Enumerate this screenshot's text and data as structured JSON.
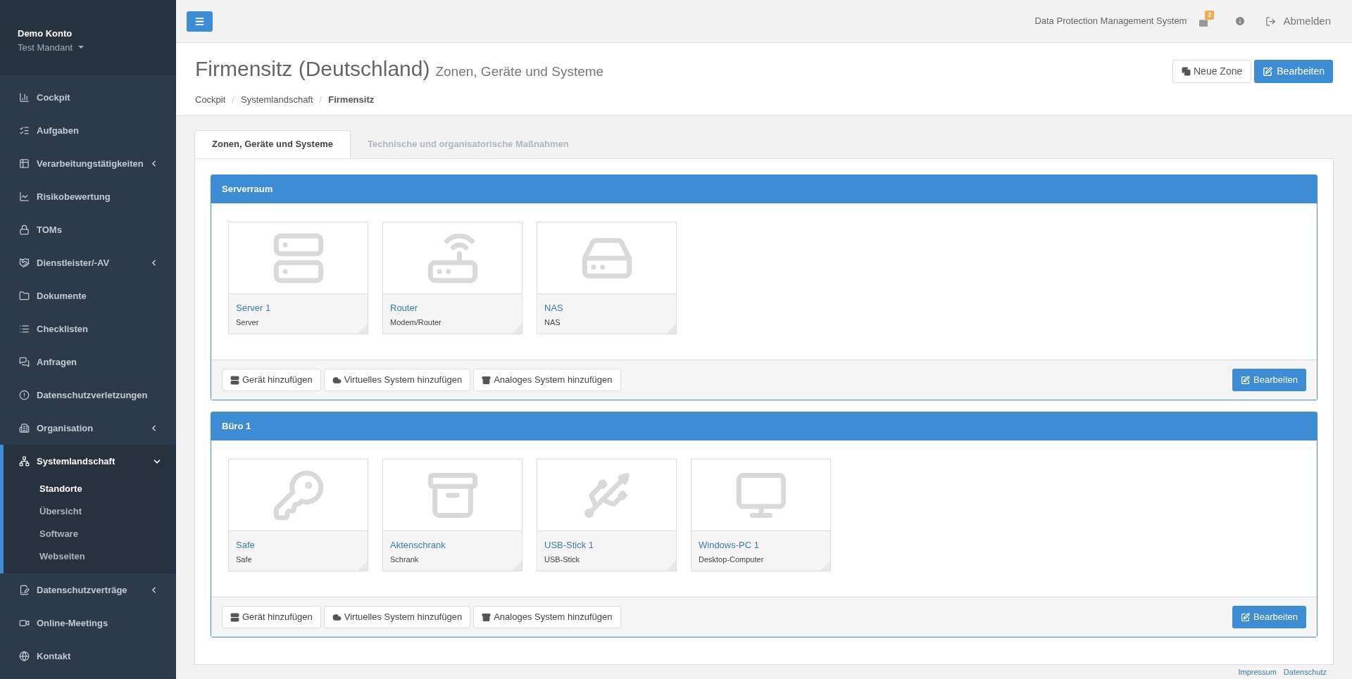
{
  "account": {
    "name": "Demo Konto",
    "tenant": "Test Mandant"
  },
  "sidebar": {
    "items": [
      {
        "label": "Cockpit",
        "kind": "chart",
        "has_submenu": false,
        "expanded": false
      },
      {
        "label": "Aufgaben",
        "kind": "tasks",
        "has_submenu": false,
        "expanded": false
      },
      {
        "label": "Verarbeitungstätigkeiten",
        "kind": "table",
        "has_submenu": true,
        "expanded": false
      },
      {
        "label": "Risikobewertung",
        "kind": "trend",
        "has_submenu": false,
        "expanded": false
      },
      {
        "label": "TOMs",
        "kind": "lock",
        "has_submenu": false,
        "expanded": false
      },
      {
        "label": "Dienstleister/-AV",
        "kind": "handshake",
        "has_submenu": true,
        "expanded": false
      },
      {
        "label": "Dokumente",
        "kind": "folder",
        "has_submenu": false,
        "expanded": false
      },
      {
        "label": "Checklisten",
        "kind": "list",
        "has_submenu": false,
        "expanded": false
      },
      {
        "label": "Anfragen",
        "kind": "chat",
        "has_submenu": false,
        "expanded": false
      },
      {
        "label": "Datenschutzverletzungen",
        "kind": "alert",
        "has_submenu": false,
        "expanded": false
      },
      {
        "label": "Organisation",
        "kind": "building",
        "has_submenu": true,
        "expanded": false
      },
      {
        "label": "Systemlandschaft",
        "kind": "network",
        "has_submenu": true,
        "expanded": true,
        "children": [
          {
            "label": "Standorte",
            "selected": true
          },
          {
            "label": "Übersicht",
            "selected": false
          },
          {
            "label": "Software",
            "selected": false
          },
          {
            "label": "Webseiten",
            "selected": false
          }
        ]
      },
      {
        "label": "Datenschutzverträge",
        "kind": "contract",
        "has_submenu": true,
        "expanded": false
      },
      {
        "label": "Online-Meetings",
        "kind": "video",
        "has_submenu": false,
        "expanded": false
      },
      {
        "label": "Kontakt",
        "kind": "globe",
        "has_submenu": false,
        "expanded": false
      }
    ]
  },
  "topbar": {
    "app_name": "Data Protection Management System",
    "message_count": "2",
    "logout": "Abmelden"
  },
  "header": {
    "title": "Firmensitz (Deutschland)",
    "subtitle": "Zonen, Geräte und Systeme",
    "breadcrumbs": [
      "Cockpit",
      "Systemlandschaft",
      "Firmensitz"
    ],
    "breadcrumb_separator": "/",
    "buttons": [
      {
        "label": "Neue Zone",
        "kind": "default"
      },
      {
        "label": "Bearbeiten",
        "kind": "primary"
      }
    ]
  },
  "tabs": [
    {
      "label": "Zonen, Geräte und Systeme",
      "selected": true
    },
    {
      "label": "Technische und organisatorische Maßnahmen",
      "selected": false
    }
  ],
  "zones": [
    {
      "title": "Serverraum",
      "devices": [
        {
          "name": "Server 1",
          "type": "Server",
          "kind": "server"
        },
        {
          "name": "Router",
          "type": "Modem/Router",
          "kind": "router"
        },
        {
          "name": "NAS",
          "type": "NAS",
          "kind": "nas"
        }
      ],
      "actions": [
        "Gerät hinzufügen",
        "Virtuelles System hinzufügen",
        "Analoges System hinzufügen"
      ],
      "edit": "Bearbeiten"
    },
    {
      "title": "Büro 1",
      "devices": [
        {
          "name": "Safe",
          "type": "Safe",
          "kind": "key"
        },
        {
          "name": "Aktenschrank",
          "type": "Schrank",
          "kind": "cabinet"
        },
        {
          "name": "USB-Stick 1",
          "type": "USB-Stick",
          "kind": "usb"
        },
        {
          "name": "Windows-PC 1",
          "type": "Desktop-Computer",
          "kind": "desktop"
        }
      ],
      "actions": [
        "Gerät hinzufügen",
        "Virtuelles System hinzufügen",
        "Analoges System hinzufügen"
      ],
      "edit": "Bearbeiten"
    }
  ],
  "footer": {
    "links": [
      "Impressum",
      "Datenschutz"
    ]
  }
}
